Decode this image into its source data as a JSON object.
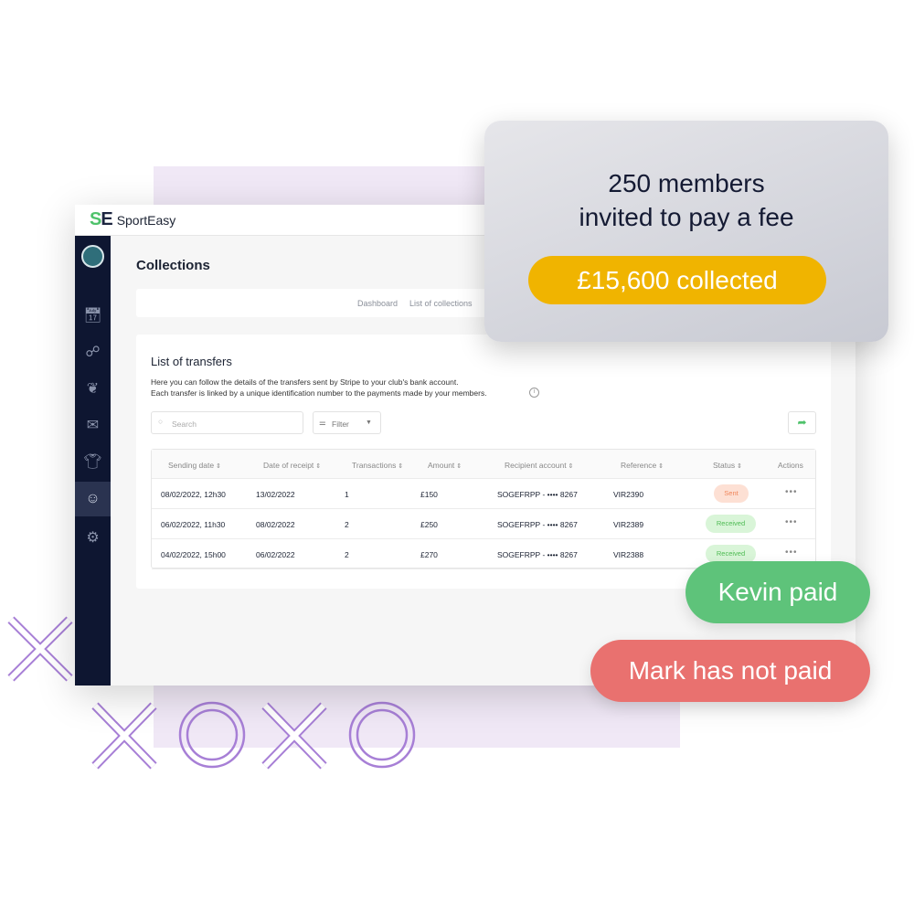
{
  "app": {
    "logo": "SE",
    "brand": "SportEasy"
  },
  "sidebar": {
    "items": [
      {
        "icon": "calendar-icon"
      },
      {
        "icon": "members-icon"
      },
      {
        "icon": "laurel-icon"
      },
      {
        "icon": "mail-icon"
      },
      {
        "icon": "shirt-icon"
      },
      {
        "icon": "hand-payment-icon",
        "active": true
      },
      {
        "icon": "gear-icon"
      }
    ]
  },
  "page": {
    "title": "Collections",
    "tabs": [
      "Dashboard",
      "List of collections"
    ]
  },
  "transfers": {
    "title": "List of transfers",
    "desc1": "Here you can follow the details of the transfers sent by Stripe to your club's bank account.",
    "desc2": "Each transfer is linked by a unique identification number to the payments made by your members.",
    "search_placeholder": "Search",
    "filter_label": "Filter",
    "columns": [
      "Sending date",
      "Date of receipt",
      "Transactions",
      "Amount",
      "Recipient account",
      "Reference",
      "Status",
      "Actions"
    ],
    "rows": [
      [
        "08/02/2022, 12h30",
        "13/02/2022",
        "1",
        "£150",
        "SOGEFRPP - •••• 8267",
        "VIR2390",
        "Sent"
      ],
      [
        "06/02/2022, 11h30",
        "08/02/2022",
        "2",
        "£250",
        "SOGEFRPP - •••• 8267",
        "VIR2389",
        "Received"
      ],
      [
        "04/02/2022, 15h00",
        "06/02/2022",
        "2",
        "£270",
        "SOGEFRPP - •••• 8267",
        "VIR2388",
        "Received"
      ]
    ]
  },
  "overlay": {
    "line1": "250 members",
    "line2": "invited to pay a fee",
    "collected": "£15,600 collected"
  },
  "tags": {
    "kevin": "Kevin paid",
    "mark": "Mark has not paid"
  },
  "colors": {
    "accent": "#4fc26b",
    "sidebar": "#0e1631",
    "yellow": "#f0b400",
    "paid": "#5ec37a",
    "unpaid": "#e9716f",
    "deco": "#a77fd6"
  }
}
